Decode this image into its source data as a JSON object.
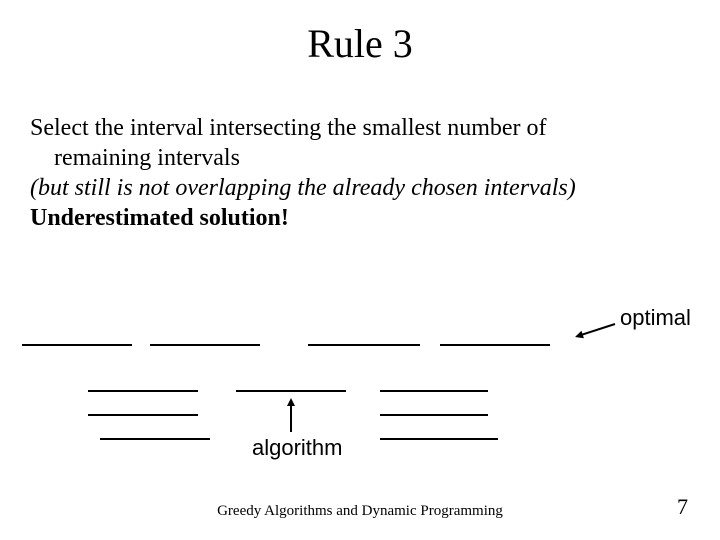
{
  "title": "Rule 3",
  "body": {
    "line1a": "Select the interval intersecting the smallest number of",
    "line1b": "remaining intervals",
    "line2": "(but still is not overlapping the already chosen intervals)",
    "line3": "Underestimated solution!"
  },
  "labels": {
    "optimal": "optimal",
    "algorithm": "algorithm"
  },
  "footer": {
    "title": "Greedy Algorithms and Dynamic Programming",
    "page": "7"
  }
}
